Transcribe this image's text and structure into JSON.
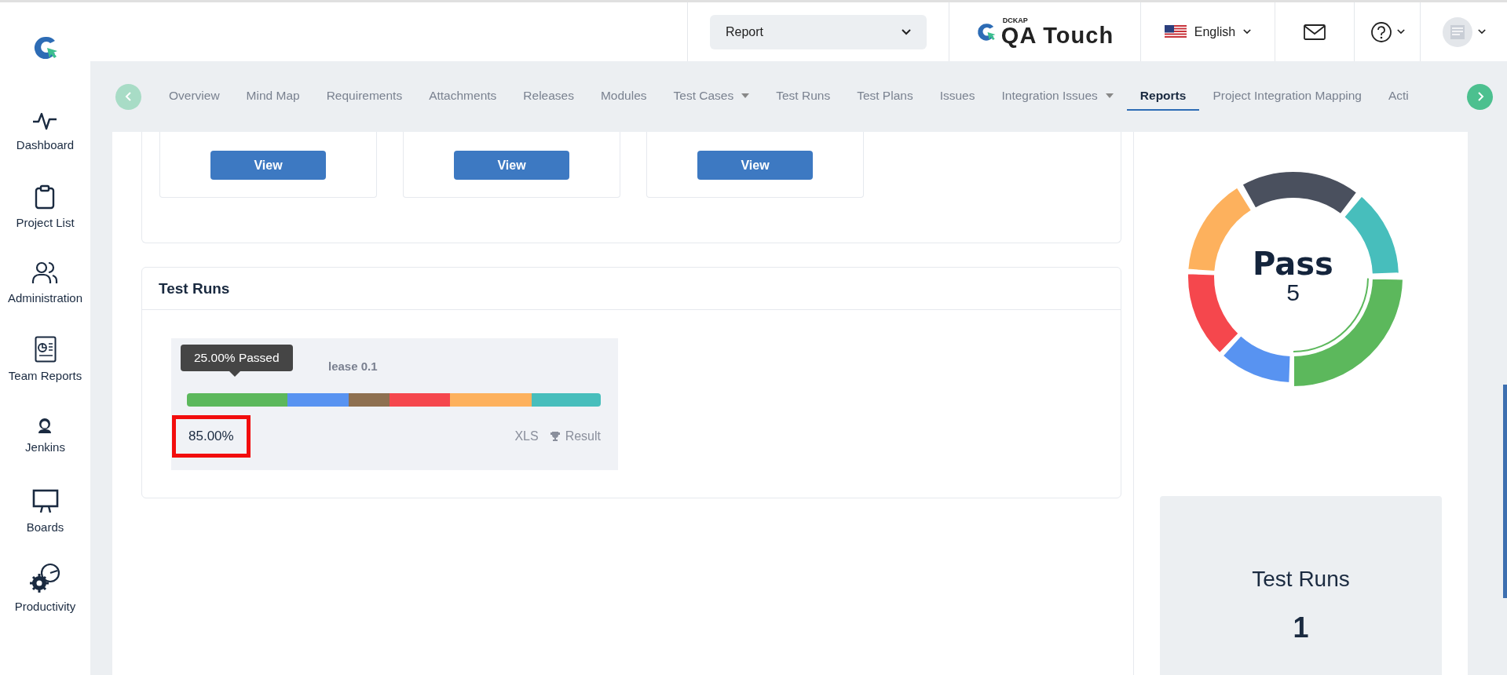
{
  "sidebar": {
    "items": [
      {
        "kind": "pulse",
        "label": "Dashboard"
      },
      {
        "kind": "clipboard",
        "label": "Project List"
      },
      {
        "kind": "users",
        "label": "Administration"
      },
      {
        "kind": "report",
        "label": "Team Reports"
      },
      {
        "kind": "butler",
        "label": "Jenkins"
      },
      {
        "kind": "board",
        "label": "Boards"
      },
      {
        "kind": "gauge",
        "label": "Productivity"
      }
    ]
  },
  "header": {
    "project_select": "Report",
    "logo_small": "DCKAP",
    "logo": "QA Touch",
    "language": "English"
  },
  "tabs": [
    {
      "label": "Overview",
      "selected": false,
      "dropdown": false
    },
    {
      "label": "Mind Map",
      "selected": false,
      "dropdown": false
    },
    {
      "label": "Requirements",
      "selected": false,
      "dropdown": false
    },
    {
      "label": "Attachments",
      "selected": false,
      "dropdown": false
    },
    {
      "label": "Releases",
      "selected": false,
      "dropdown": false
    },
    {
      "label": "Modules",
      "selected": false,
      "dropdown": false
    },
    {
      "label": "Test Cases",
      "selected": false,
      "dropdown": true
    },
    {
      "label": "Test Runs",
      "selected": false,
      "dropdown": false
    },
    {
      "label": "Test Plans",
      "selected": false,
      "dropdown": false
    },
    {
      "label": "Issues",
      "selected": false,
      "dropdown": false
    },
    {
      "label": "Integration Issues",
      "selected": false,
      "dropdown": true
    },
    {
      "label": "Reports",
      "selected": true,
      "dropdown": false
    },
    {
      "label": "Project Integration Mapping",
      "selected": false,
      "dropdown": false
    },
    {
      "label": "Acti",
      "selected": false,
      "dropdown": false
    }
  ],
  "report_cards": [
    {
      "button": "View"
    },
    {
      "button": "View"
    },
    {
      "button": "View"
    }
  ],
  "test_runs": {
    "title": "Test Runs",
    "run": {
      "name": "lease 0.1",
      "tooltip": "25.00% Passed",
      "percent": "85.00%",
      "highlighted": true,
      "export": "XLS",
      "result": "Result",
      "segments": [
        {
          "color": "#5cb85c"
        },
        {
          "color": "#5893f1"
        },
        {
          "color": "#8e7050"
        },
        {
          "color": "#f5474d"
        },
        {
          "color": "#fdb15d"
        },
        {
          "color": "#47bebc"
        }
      ]
    }
  },
  "summary": {
    "center_label": "Pass",
    "center_value": "5",
    "stat_label": "Test Runs",
    "stat_value": "1"
  }
}
